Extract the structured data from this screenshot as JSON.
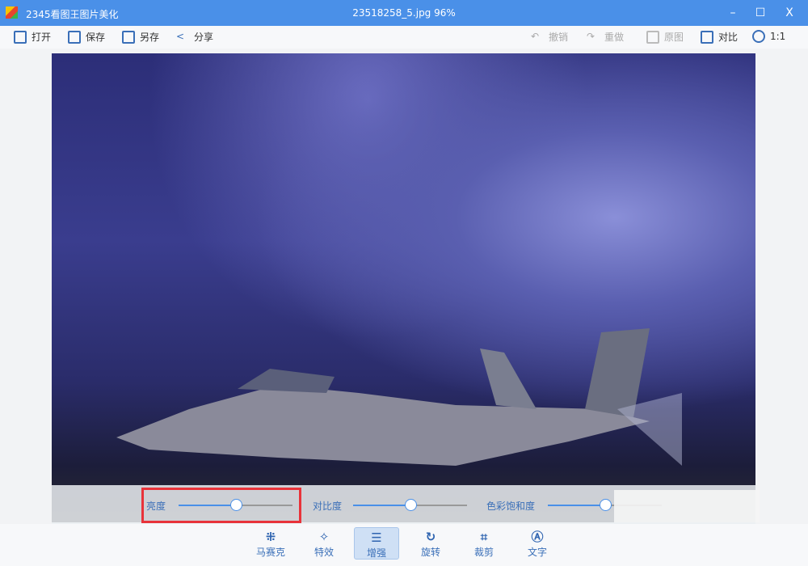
{
  "window": {
    "app_title": "2345看图王图片美化",
    "file_title": "23518258_5.jpg  96%",
    "minimize": "–",
    "maximize": "☐",
    "close": "X"
  },
  "toolbar": {
    "open": "打开",
    "save": "保存",
    "save_as": "另存",
    "share": "分享",
    "undo": "撤销",
    "redo": "重做",
    "original": "原图",
    "compare": "对比",
    "actual_size": "1:1"
  },
  "adjust": {
    "brightness": {
      "label": "亮度",
      "value": 50
    },
    "contrast": {
      "label": "对比度",
      "value": 50
    },
    "saturation": {
      "label": "色彩饱和度",
      "value": 50
    }
  },
  "bottom": {
    "items": [
      {
        "label": "马赛克",
        "icon": "mosaic-icon",
        "glyph": "⁜"
      },
      {
        "label": "特效",
        "icon": "magic-wand-icon",
        "glyph": "✧"
      },
      {
        "label": "增强",
        "icon": "sliders-icon",
        "glyph": "☰",
        "active": true
      },
      {
        "label": "旋转",
        "icon": "rotate-icon",
        "glyph": "↻"
      },
      {
        "label": "裁剪",
        "icon": "crop-icon",
        "glyph": "⌗"
      },
      {
        "label": "文字",
        "icon": "text-icon",
        "glyph": "Ⓐ"
      }
    ]
  },
  "colors": {
    "accent": "#4a90e8",
    "highlight": "#e8333a"
  }
}
